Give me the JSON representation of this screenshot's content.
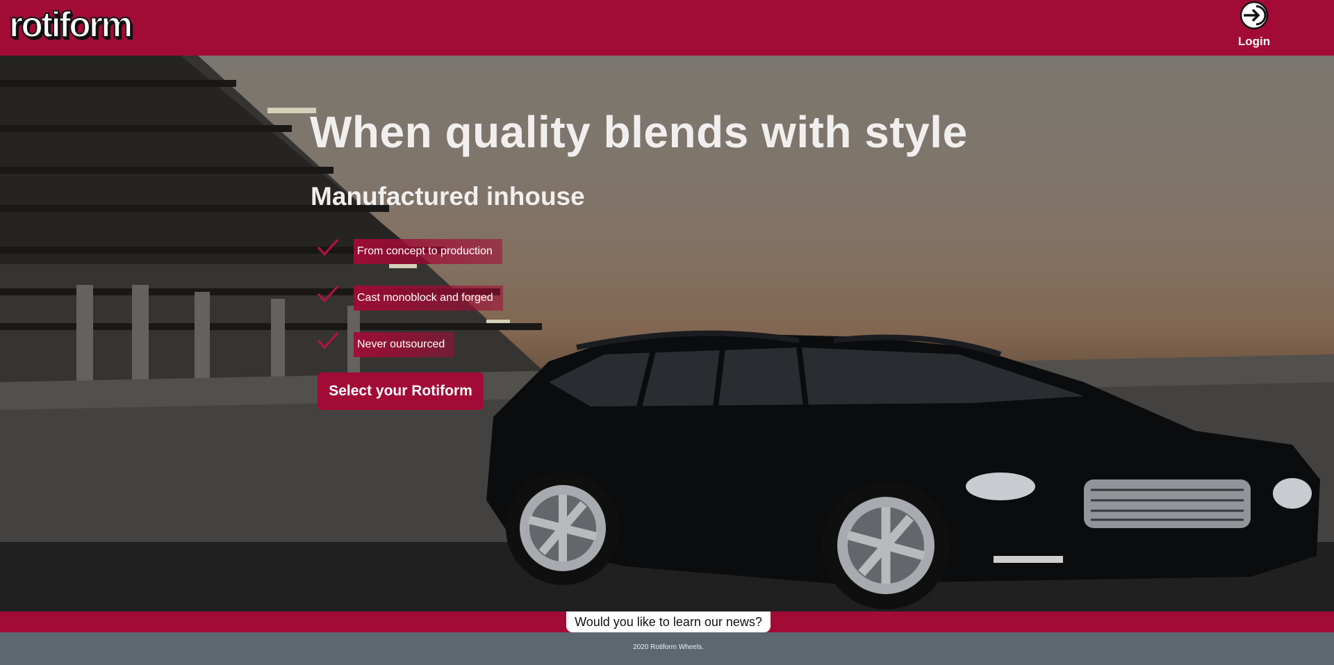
{
  "header": {
    "logo_text": "rotiform",
    "login_label": "Login",
    "login_icon": "login-arrow-icon",
    "brand_color": "#a20b36"
  },
  "hero": {
    "title": "When quality blends with style",
    "subtitle": "Manufactured inhouse",
    "features": [
      {
        "label": "From concept to production",
        "icon": "checkmark-icon"
      },
      {
        "label": "Cast monoblock and forged",
        "icon": "checkmark-icon"
      },
      {
        "label": "Never outsourced",
        "icon": "checkmark-icon"
      }
    ],
    "cta_label": "Select your Rotiform"
  },
  "newsletter": {
    "prompt": "Would you like to learn our news?"
  },
  "footer": {
    "copyright": "2020 Rotiform Wheels.",
    "background_color": "#5d6770"
  }
}
